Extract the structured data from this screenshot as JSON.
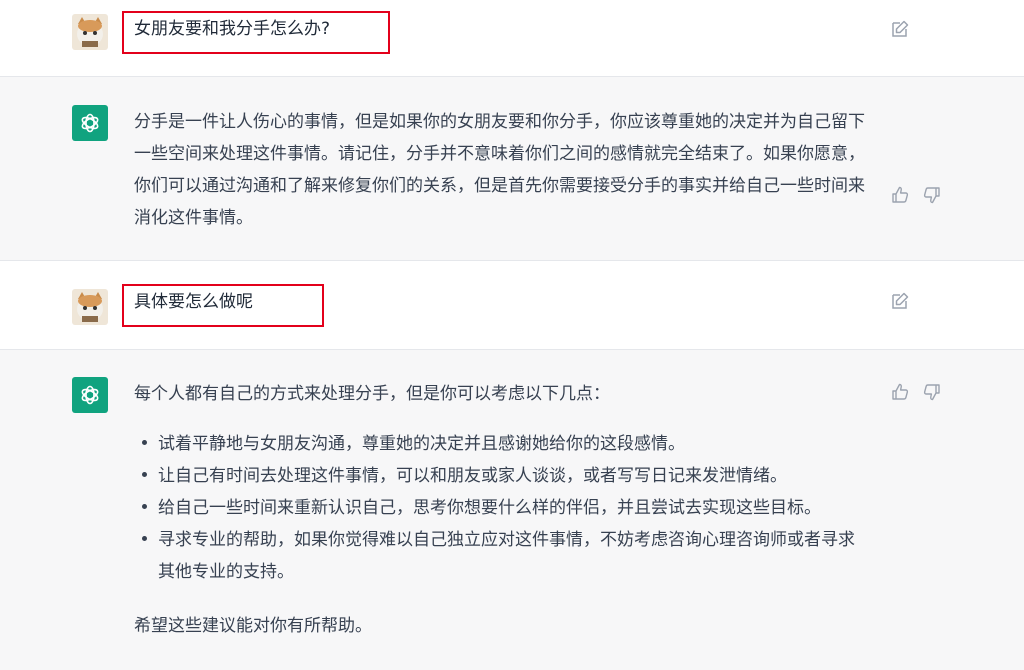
{
  "conversation": [
    {
      "role": "user",
      "text": "女朋友要和我分手怎么办?"
    },
    {
      "role": "assistant",
      "text": "分手是一件让人伤心的事情，但是如果你的女朋友要和你分手，你应该尊重她的决定并为自己留下一些空间来处理这件事情。请记住，分手并不意味着你们之间的感情就完全结束了。如果你愿意，你们可以通过沟通和了解来修复你们的关系，但是首先你需要接受分手的事实并给自己一些时间来消化这件事情。"
    },
    {
      "role": "user",
      "text": "具体要怎么做呢"
    },
    {
      "role": "assistant",
      "intro": "每个人都有自己的方式来处理分手，但是你可以考虑以下几点：",
      "points": [
        "试着平静地与女朋友沟通，尊重她的决定并且感谢她给你的这段感情。",
        "让自己有时间去处理这件事情，可以和朋友或家人谈谈，或者写写日记来发泄情绪。",
        "给自己一些时间来重新认识自己，思考你想要什么样的伴侣，并且尝试去实现这些目标。",
        "寻求专业的帮助，如果你觉得难以自己独立应对这件事情，不妨考虑咨询心理咨询师或者寻求其他专业的支持。"
      ],
      "outro": "希望这些建议能对你有所帮助。"
    }
  ],
  "icons": {
    "user_avatar": "user-avatar-icon",
    "bot_avatar": "openai-logo-icon",
    "edit": "edit-icon",
    "thumbs_up": "thumbs-up-icon",
    "thumbs_down": "thumbs-down-icon"
  },
  "colors": {
    "accent": "#10a37f",
    "highlight_box": "#e3001b",
    "assistant_bg": "#f7f7f8"
  }
}
